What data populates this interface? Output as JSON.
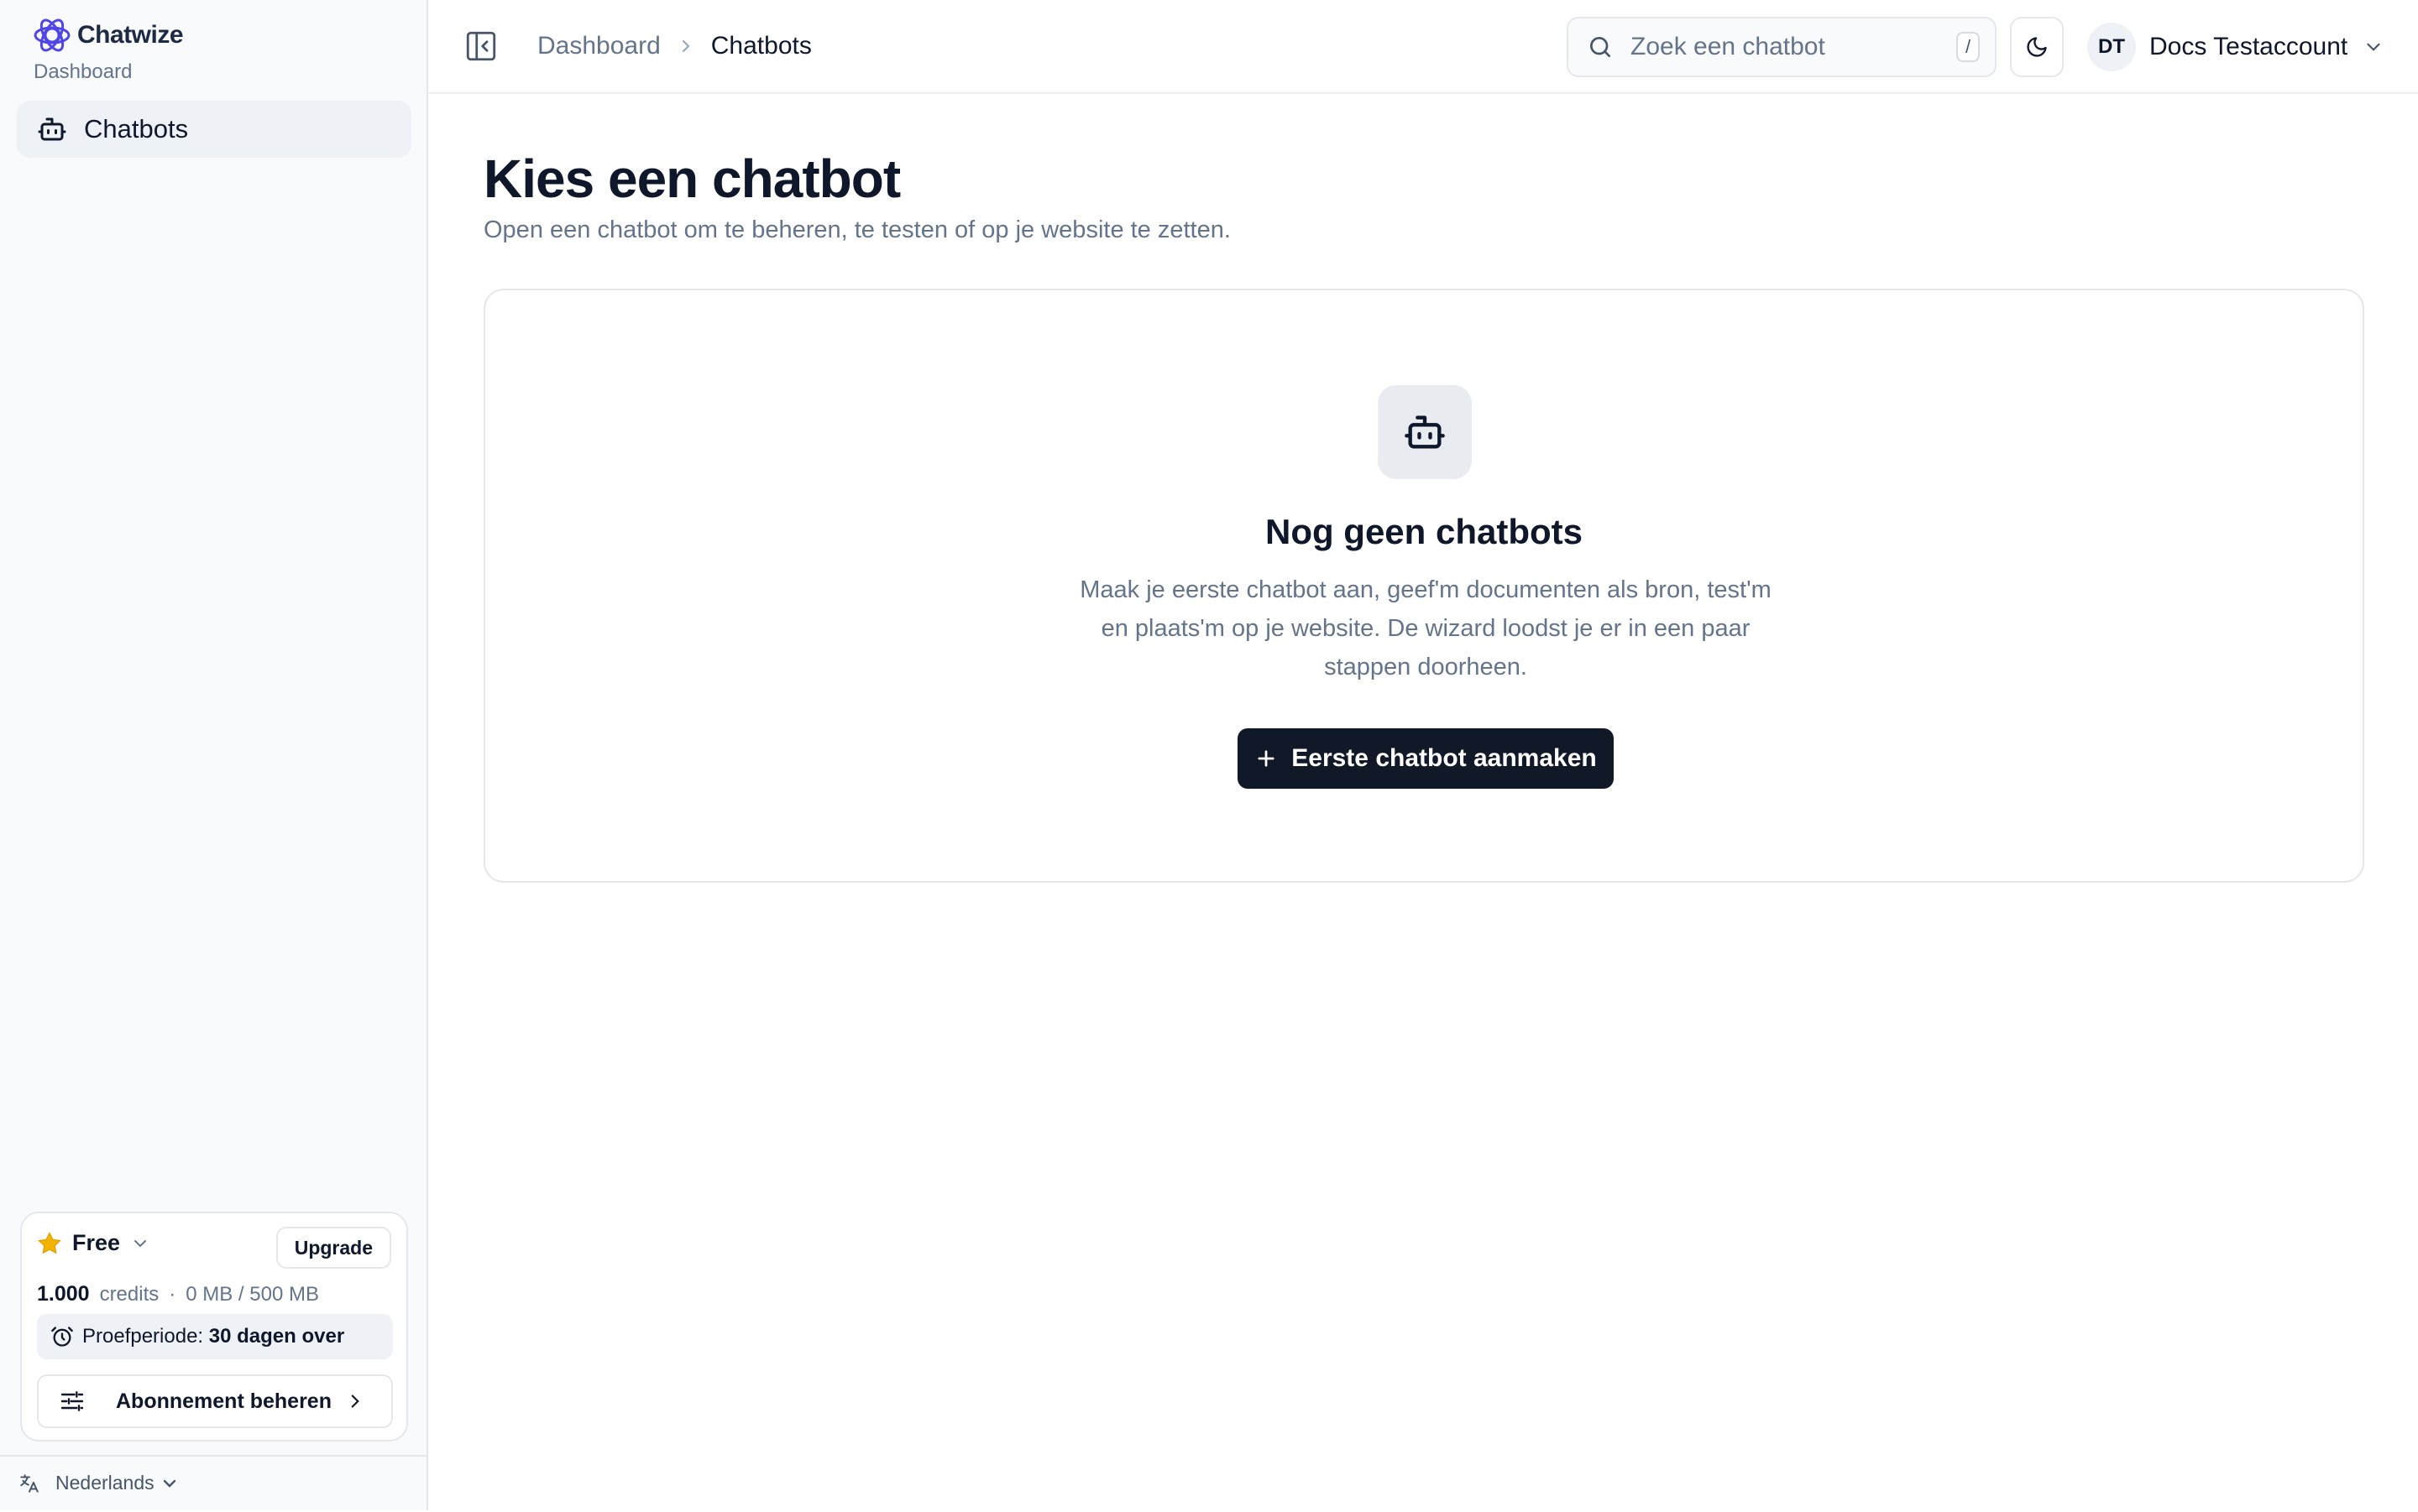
{
  "brand": {
    "name": "Chatwize",
    "subtitle": "Dashboard"
  },
  "sidebar": {
    "items": [
      {
        "label": "Chatbots",
        "icon": "bot-icon",
        "active": true
      }
    ]
  },
  "plan": {
    "name": "Free",
    "upgrade_label": "Upgrade",
    "credits_value": "1.000",
    "credits_label": "credits",
    "separator": "·",
    "storage": "0 MB / 500 MB",
    "trial_label": "Proefperiode:",
    "trial_value": "30 dagen over",
    "manage_label": "Abonnement beheren"
  },
  "language": {
    "label": "Nederlands"
  },
  "header": {
    "breadcrumb": [
      "Dashboard",
      "Chatbots"
    ],
    "search_placeholder": "Zoek een chatbot",
    "search_value": "",
    "search_shortcut": "/",
    "avatar_initials": "DT",
    "account_name": "Docs Testaccount"
  },
  "main": {
    "title": "Kies een chatbot",
    "subtitle": "Open een chatbot om te beheren, te testen of op je website te zetten.",
    "empty_state": {
      "title": "Nog geen chatbots",
      "text": "Maak je eerste chatbot aan, geef'm documenten als bron, test'm en plaats'm op je website. De wizard loodst je er in een paar stappen doorheen.",
      "button_label": "Eerste chatbot aanmaken"
    }
  },
  "colors": {
    "brand": "#4f46e5",
    "primary_button": "#111827",
    "star": "#f5b301",
    "muted_text": "#64748b",
    "sidebar_bg": "#f8fafc"
  }
}
